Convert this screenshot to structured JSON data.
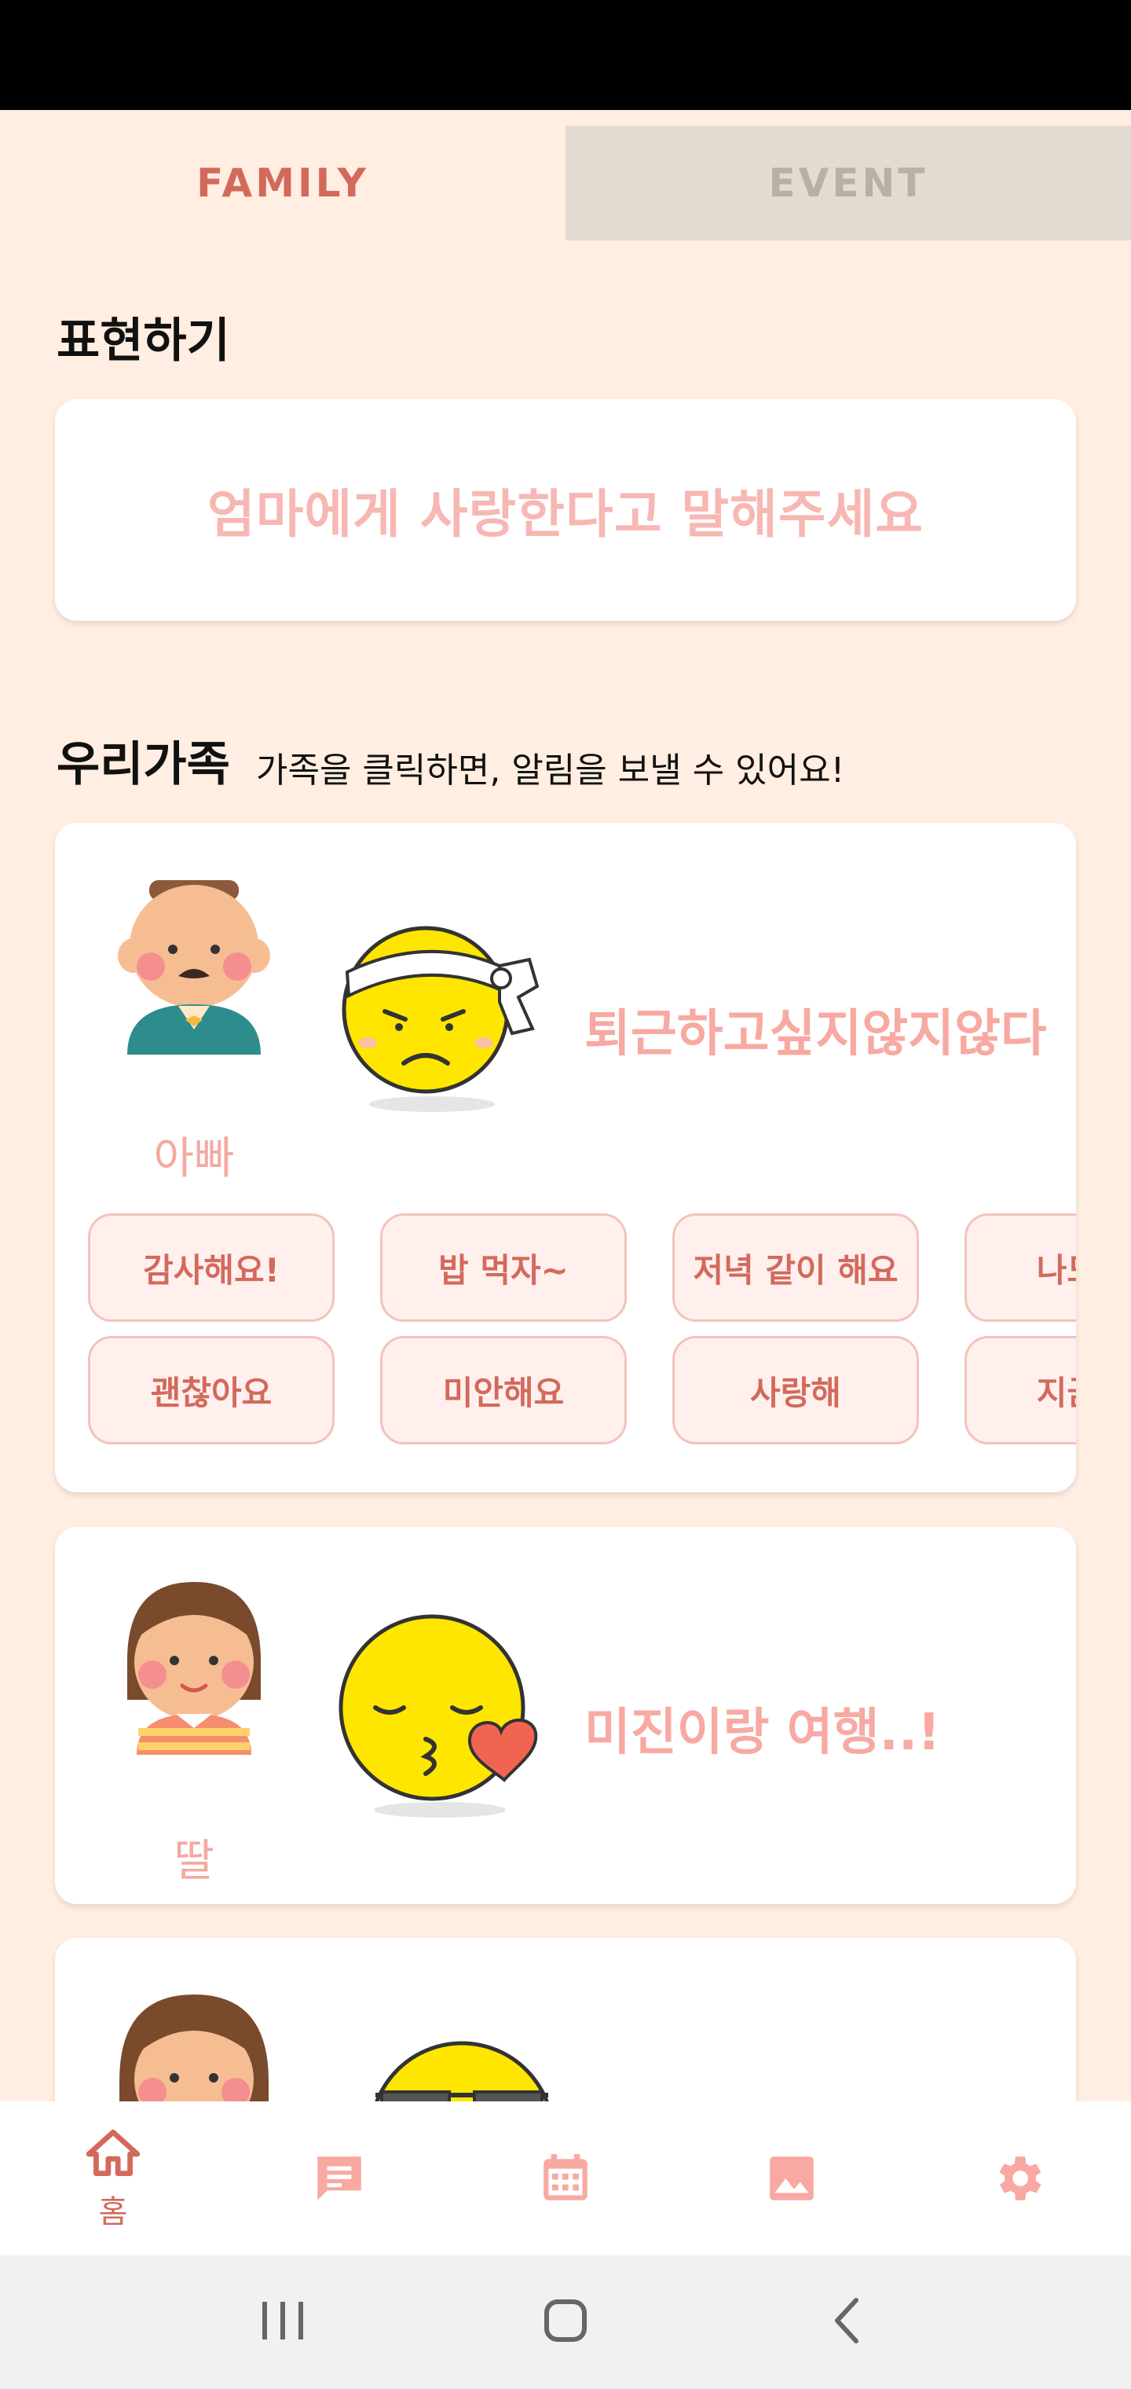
{
  "tabs": [
    {
      "label": "FAMILY",
      "active": true
    },
    {
      "label": "EVENT",
      "active": false
    }
  ],
  "express": {
    "title": "표현하기",
    "message": "엄마에게 사랑한다고 말해주세요"
  },
  "family": {
    "title": "우리가족",
    "subtitle": "가족을 클릭하면, 알림을 보낼 수 있어요!",
    "members": [
      {
        "name": "아빠",
        "status": "퇴근하고싶지않지않다",
        "emoji": "headband-frowning-emoji",
        "quick_replies_row1": [
          "감사해요!",
          "밥 먹자~",
          "저녁 같이 해요",
          "나도 사"
        ],
        "quick_replies_row2": [
          "괜찮아요",
          "미안해요",
          "사랑해",
          "지금 통"
        ]
      },
      {
        "name": "딸",
        "status": "미진이랑 여행..!",
        "emoji": "kissing-heart-emoji"
      },
      {
        "name": "",
        "status": "",
        "emoji": "sunglasses-emoji"
      }
    ]
  },
  "nav": [
    {
      "icon": "home-icon",
      "label": "홈",
      "active": true
    },
    {
      "icon": "chat-icon",
      "label": ""
    },
    {
      "icon": "calendar-icon",
      "label": ""
    },
    {
      "icon": "image-icon",
      "label": ""
    },
    {
      "icon": "settings-icon",
      "label": ""
    }
  ],
  "colors": {
    "background": "#FFEEE1",
    "accent": "#D26A5C",
    "accent_light": "#F7A9A2",
    "tab_inactive": "#E2DBD2"
  }
}
